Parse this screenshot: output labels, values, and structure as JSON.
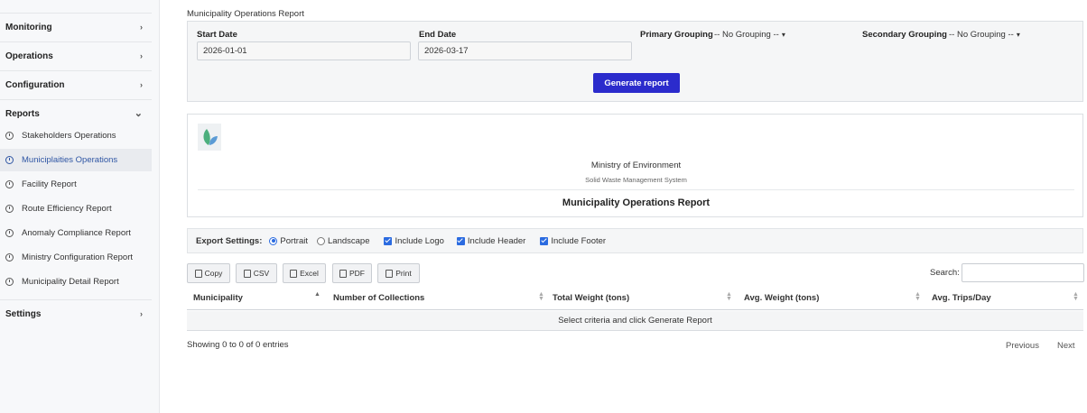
{
  "sidebar": {
    "sections": [
      {
        "label": "Monitoring",
        "icon": "chevron-right-icon",
        "glyph": "›"
      },
      {
        "label": "Operations",
        "icon": "chevron-right-icon",
        "glyph": "›"
      },
      {
        "label": "Configuration",
        "icon": "chevron-right-icon",
        "glyph": "›"
      },
      {
        "label": "Reports",
        "icon": "chevron-down-icon",
        "glyph": "⌄"
      },
      {
        "label": "Settings",
        "icon": "chevron-right-icon",
        "glyph": "›"
      }
    ],
    "report_items": [
      {
        "label": "Stakeholders Operations",
        "active": false
      },
      {
        "label": "Municiplaities Operations",
        "active": true
      },
      {
        "label": "Facility Report",
        "active": false
      },
      {
        "label": "Route Efficiency Report",
        "active": false
      },
      {
        "label": "Anomaly Compliance Report",
        "active": false
      },
      {
        "label": "Ministry Configuration Report",
        "active": false
      },
      {
        "label": "Municipality Detail Report",
        "active": false
      }
    ]
  },
  "page": {
    "title": "Municipality Operations Report"
  },
  "filters": {
    "start_label": "Start Date",
    "start_value": "2026-01-01",
    "end_label": "End Date",
    "end_value": "2026-03-17",
    "primary_label": "Primary Grouping",
    "primary_value": "-- No Grouping --",
    "secondary_label": "Secondary Grouping",
    "secondary_value": "-- No Grouping --",
    "generate_label": "Generate report"
  },
  "report_header": {
    "organization": "Ministry of Environment",
    "system": "Solid Waste Management System",
    "title": "Municipality Operations Report"
  },
  "export": {
    "label": "Export Settings:",
    "portrait": "Portrait",
    "landscape": "Landscape",
    "orientation_selected": "Portrait",
    "include_logo": "Include Logo",
    "include_header": "Include Header",
    "include_footer": "Include Footer"
  },
  "table_tools": {
    "copy": "Copy",
    "csv": "CSV",
    "excel": "Excel",
    "pdf": "PDF",
    "print": "Print",
    "search_label": "Search:"
  },
  "table": {
    "columns": [
      "Municipality",
      "Number of Collections",
      "Total Weight (tons)",
      "Avg. Weight (tons)",
      "Avg. Trips/Day"
    ],
    "empty_message": "Select criteria and click Generate Report",
    "info": "Showing 0 to 0 of 0 entries",
    "previous": "Previous",
    "next": "Next"
  },
  "colors": {
    "accent": "#2b2bcc",
    "active_nav": "#2f56a4",
    "checkbox": "#2b6be0"
  }
}
